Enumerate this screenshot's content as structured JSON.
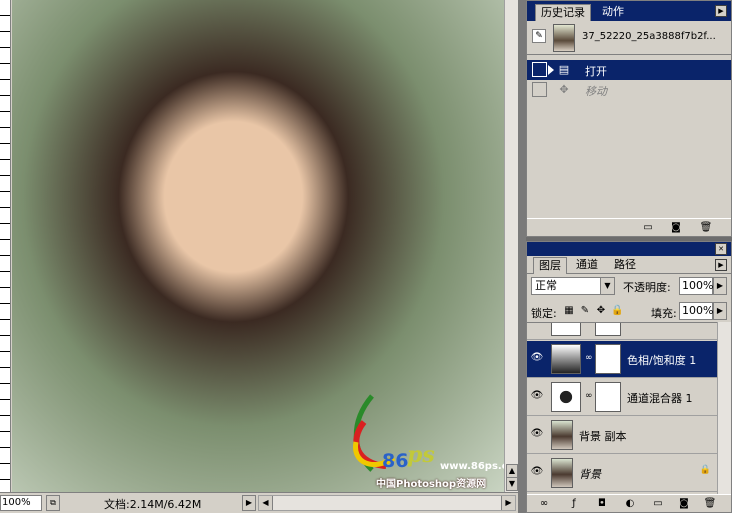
{
  "document": {
    "zoom": "100%",
    "doc_info": "文档:2.14M/6.42M",
    "photo_placeholder": "",
    "watermark": {
      "brand_86": "86",
      "brand_ps": "ps",
      "url": "www.86ps.com",
      "site_name": "中国Photoshop资源网"
    }
  },
  "history_panel": {
    "tabs": [
      "历史记录",
      "动作"
    ],
    "snapshot_label": "37_52220_25a3888f7b2f...",
    "items": [
      {
        "label": "打开",
        "state": "active"
      },
      {
        "label": "移动",
        "state": "undone"
      }
    ]
  },
  "layers_panel": {
    "tabs": [
      "图层",
      "通道",
      "路径"
    ],
    "blend_mode": "正常",
    "opacity_label": "不透明度:",
    "opacity_value": "100%",
    "lock_label": "锁定:",
    "fill_label": "填充:",
    "fill_value": "100%",
    "layers": [
      {
        "name": "色相/饱和度 1",
        "selected": true
      },
      {
        "name": "通道混合器 1",
        "selected": false
      },
      {
        "name": "背景 副本",
        "selected": false
      },
      {
        "name": "背景",
        "selected": false
      }
    ]
  },
  "colors": {
    "selection": "#0a246a",
    "panel_bg": "#d4d0c8",
    "workspace": "#6d6d6d"
  }
}
